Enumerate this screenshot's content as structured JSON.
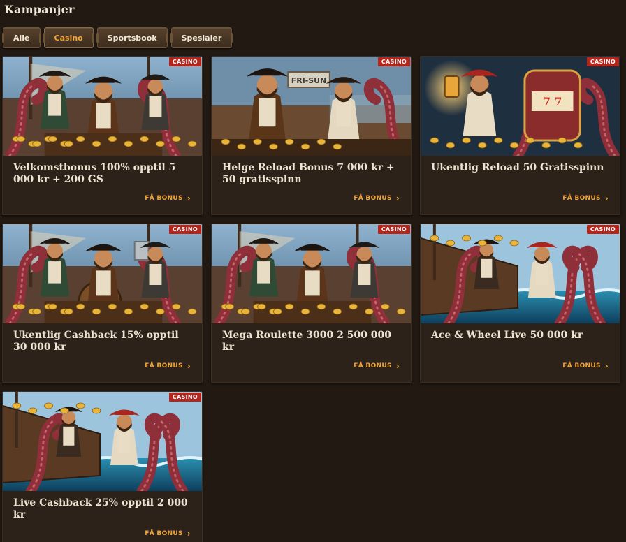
{
  "page": {
    "title": "Kampanjer"
  },
  "filters": [
    {
      "label": "Alle",
      "active": false
    },
    {
      "label": "Casino",
      "active": true
    },
    {
      "label": "Sportsbook",
      "active": false
    },
    {
      "label": "Spesialer",
      "active": false
    }
  ],
  "cards": [
    {
      "badge": "CASINO",
      "title": "Velkomstbonus 100% opptil 5 000 kr + 200 GS",
      "cta": "FÅ BONUS",
      "scene": "crew"
    },
    {
      "badge": "CASINO",
      "title": "Helge Reload Bonus 7 000 kr + 50 gratisspinn",
      "cta": "FÅ BONUS",
      "scene": "duo"
    },
    {
      "badge": "CASINO",
      "title": "Ukentlig Reload 50 Gratisspinn",
      "cta": "FÅ BONUS",
      "scene": "slot"
    },
    {
      "badge": "CASINO",
      "title": "Ukentlig Cashback 15% opptil 30 000 kr",
      "cta": "FÅ BONUS",
      "scene": "barrel"
    },
    {
      "badge": "CASINO",
      "title": "Mega Roulette 3000 2 500 000 kr",
      "cta": "FÅ BONUS",
      "scene": "crew"
    },
    {
      "badge": "CASINO",
      "title": "Ace & Wheel Live 50 000 kr",
      "cta": "FÅ BONUS",
      "scene": "kraken"
    },
    {
      "badge": "CASINO",
      "title": "Live Cashback 25% opptil 2 000 kr",
      "cta": "FÅ BONUS",
      "scene": "kraken"
    }
  ],
  "colors": {
    "background": "#211912",
    "card": "#2c2219",
    "accent": "#f0a43a",
    "badge": "#b4251c"
  },
  "icons": {
    "cta": "chevron-right-icon"
  }
}
